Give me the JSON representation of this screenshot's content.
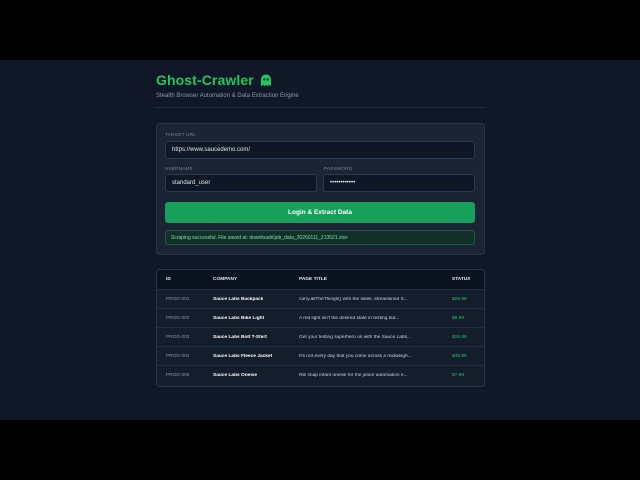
{
  "app": {
    "title": "Ghost-Crawler",
    "subtitle": "Stealth Browser Automation & Data Extraction Engine",
    "title_icon": "ghost-icon"
  },
  "form": {
    "target_url_label": "TARGET URL",
    "target_url_value": "https://www.saucedemo.com/",
    "username_label": "USERNAME",
    "username_value": "standard_user",
    "password_label": "PASSWORD",
    "password_value": "••••••••••••",
    "submit_label": "Login & Extract Data"
  },
  "status_message": "Scraping successful. File saved at: downloads\\job_data_20260111_213521.xlsx",
  "table": {
    "headers": {
      "id": "ID",
      "company": "COMPANY",
      "page_title": "PAGE TITLE",
      "status": "STATUS"
    },
    "rows": [
      {
        "id": "PROD-001",
        "company": "Sauce Labs Backpack",
        "page_title": "carry.allTheThings() with the sleek, streamlined S...",
        "status": "$29.99"
      },
      {
        "id": "PROD-002",
        "company": "Sauce Labs Bike Light",
        "page_title": "A red light isn't the desired state in testing but...",
        "status": "$9.99"
      },
      {
        "id": "PROD-003",
        "company": "Sauce Labs Bolt T-Shirt",
        "page_title": "Get your testing superhero on with the Sauce Labs...",
        "status": "$15.99"
      },
      {
        "id": "PROD-004",
        "company": "Sauce Labs Fleece Jacket",
        "page_title": "It's not every day that you come across a midweigh...",
        "status": "$49.99"
      },
      {
        "id": "PROD-005",
        "company": "Sauce Labs Onesie",
        "page_title": "Rib snap infant onesie for the junior automation e...",
        "status": "$7.99"
      }
    ]
  },
  "colors": {
    "accent": "#22c55e",
    "button": "#16a05a",
    "background": "#101828",
    "card": "#1b2434"
  }
}
